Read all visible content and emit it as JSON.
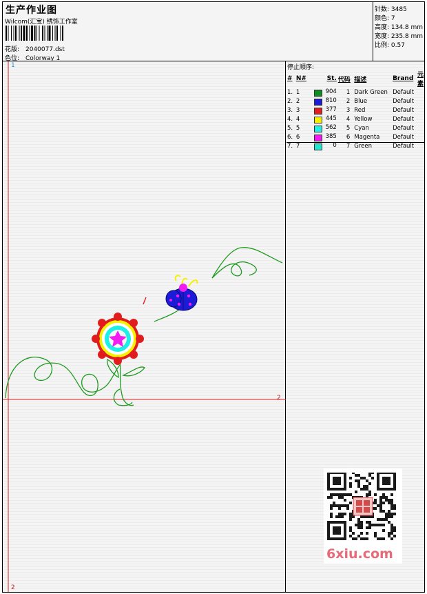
{
  "header": {
    "title": "生产作业图",
    "company": "Wilcom(汇宝) 绣饰工作室",
    "design_label": "花版:",
    "design_value": "2040077.dst",
    "colorway_label": "色位:",
    "colorway_value": "Colorway 1"
  },
  "stats": {
    "stitches": "针数: 3485",
    "colors": "颜色: 7",
    "height": "高度: 134.8 mm",
    "width": "宽度: 235.8 mm",
    "scale": "比例: 0.57"
  },
  "canvas": {
    "corner_top": "1",
    "corner_right": "2",
    "corner_bottom": "2"
  },
  "sequence": {
    "title": "停止顺序:",
    "headers": [
      "#",
      "N#",
      "St.",
      "代码",
      "描述",
      "Brand",
      "元素"
    ],
    "rows": [
      {
        "idx": "1.",
        "n": "1",
        "color": "#0f8f1f",
        "st": "904",
        "code": "1",
        "desc": "Dark Green",
        "brand": "Default"
      },
      {
        "idx": "2.",
        "n": "2",
        "color": "#1c1cd8",
        "st": "810",
        "code": "2",
        "desc": "Blue",
        "brand": "Default"
      },
      {
        "idx": "3.",
        "n": "3",
        "color": "#e81c1c",
        "st": "377",
        "code": "3",
        "desc": "Red",
        "brand": "Default"
      },
      {
        "idx": "4.",
        "n": "4",
        "color": "#f4f000",
        "st": "445",
        "code": "4",
        "desc": "Yellow",
        "brand": "Default"
      },
      {
        "idx": "5.",
        "n": "5",
        "color": "#1cf0e6",
        "st": "562",
        "code": "5",
        "desc": "Cyan",
        "brand": "Default"
      },
      {
        "idx": "6.",
        "n": "6",
        "color": "#f01cf0",
        "st": "385",
        "code": "6",
        "desc": "Magenta",
        "brand": "Default"
      },
      {
        "idx": "7.",
        "n": "7",
        "color": "#1ce8d0",
        "st": "0",
        "code": "7",
        "desc": "Green",
        "brand": "Default"
      }
    ]
  },
  "watermark": "6xiu.com",
  "icons": {
    "barcode": "barcode-icon",
    "qr": "qr-code-icon"
  }
}
